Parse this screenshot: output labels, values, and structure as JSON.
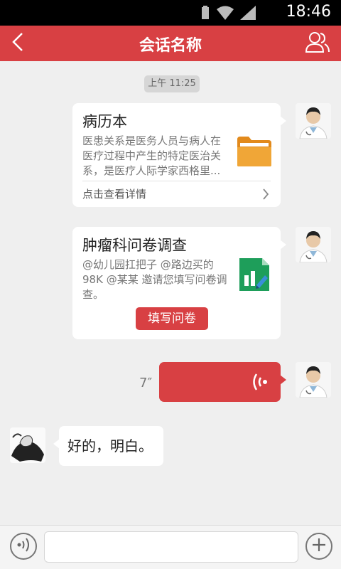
{
  "status_bar": {
    "time": "18:46"
  },
  "nav": {
    "title": "会话名称"
  },
  "chat": {
    "timestamp": "上午 11:25",
    "messages": [
      {
        "kind": "record-card",
        "title": "病历本",
        "description": "医患关系是医务人员与病人在医疗过程中产生的特定医治关系，是医疗人际学家西格里...",
        "link": "点击查看详情",
        "icon": "folder-icon"
      },
      {
        "kind": "survey-card",
        "title": "肿瘤科问卷调查",
        "description": "@幼儿园扛把子 @路边买的98K @某某 邀请您填写问卷调查。",
        "button": "填写问卷",
        "icon": "spreadsheet-icon"
      },
      {
        "kind": "voice",
        "duration": "7″"
      },
      {
        "kind": "text",
        "text": "好的，明白。"
      }
    ]
  },
  "input": {
    "placeholder": ""
  },
  "colors": {
    "brand_red": "#d84043",
    "chat_bg": "#efefef"
  }
}
